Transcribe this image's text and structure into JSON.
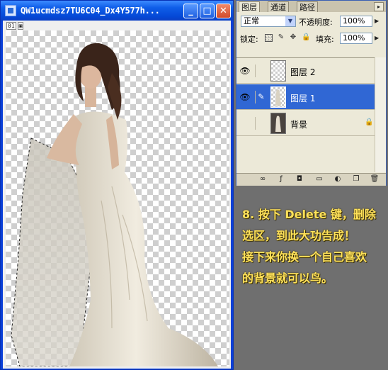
{
  "image_window": {
    "title": "QW1ucmdsz7TU6C04_Dx4Y577h...",
    "status_indicator": [
      "01",
      "▣"
    ],
    "controls": {
      "minimize": "_",
      "maximize": "□",
      "close": "✕"
    }
  },
  "layers_panel": {
    "tabs": [
      "图层",
      "通道",
      "路径"
    ],
    "blend_mode": "正常",
    "opacity_label": "不透明度:",
    "opacity_value": "100%",
    "lock_label": "锁定:",
    "fill_label": "填充:",
    "fill_value": "100%",
    "layers": [
      {
        "name": "图层 2",
        "visible": true,
        "selected": false
      },
      {
        "name": "图层 1",
        "visible": true,
        "selected": true
      },
      {
        "name": "背景",
        "visible": false,
        "selected": false,
        "locked": true
      }
    ],
    "bottom_icons": [
      "link-icon",
      "layer-style-icon",
      "mask-icon",
      "folder-icon",
      "adjustment-icon",
      "new-layer-icon",
      "trash-icon"
    ]
  },
  "caption": {
    "lines": [
      "8. 按下 Delete 键，删除",
      "选区，到此大功告成！",
      "接下来你换一个自己喜欢",
      "的背景就可以鸟。"
    ]
  },
  "colors": {
    "caption": "#ffe25a",
    "selected_layer": "#3067d4",
    "background": "#6f6f6f"
  }
}
